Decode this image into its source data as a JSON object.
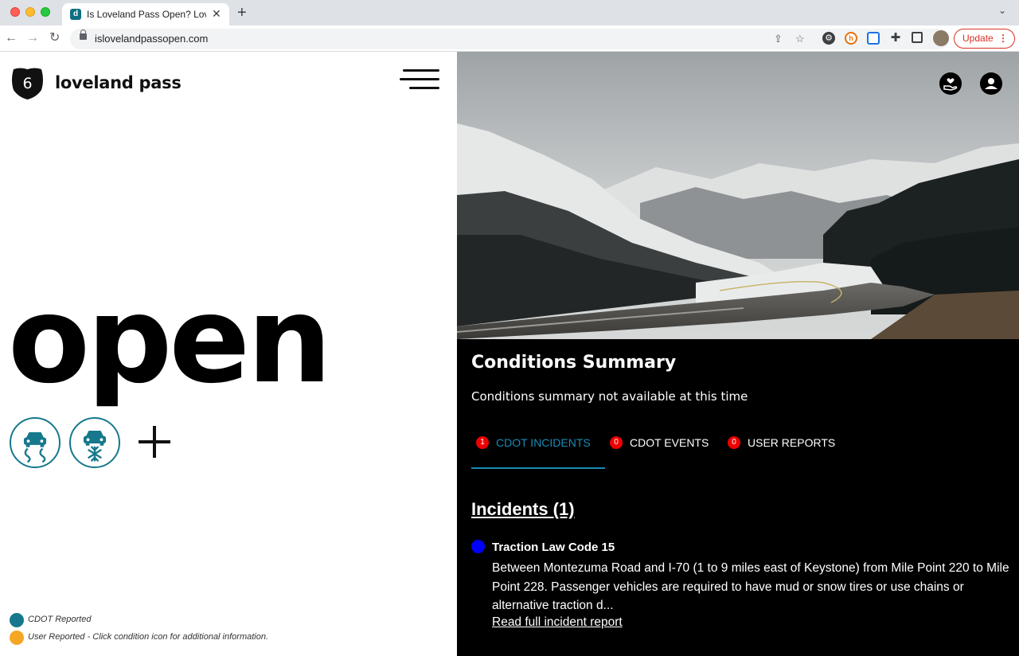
{
  "browser": {
    "tab_title": "Is Loveland Pass Open? Lovela",
    "tab_favicon_letter": "d",
    "url": "islovelandpassopen.com",
    "update_label": "Update"
  },
  "site": {
    "shield_number": "6",
    "brand": "loveland pass",
    "status": "open",
    "legend": [
      {
        "label": "CDOT Reported",
        "color": "#16788c"
      },
      {
        "label": "User Reported - Click condition icon for additional information.",
        "color": "#f5a623"
      }
    ]
  },
  "conditions": {
    "title": "Conditions Summary",
    "text": "Conditions summary not available at this time",
    "tabs": [
      {
        "count": "1",
        "label": "CDOT INCIDENTS",
        "active": true
      },
      {
        "count": "0",
        "label": "CDOT EVENTS",
        "active": false
      },
      {
        "count": "0",
        "label": "USER REPORTS",
        "active": false
      }
    ]
  },
  "incidents": {
    "heading": "Incidents (1)",
    "items": [
      {
        "title": "Traction Law Code 15",
        "body": "Between Montezuma Road and I-70 (1 to 9 miles east of Keystone) from Mile Point 220 to Mile Point 228. Passenger vehicles are required to have mud or snow tires or use chains or alternative traction d...",
        "link": "Read full incident report"
      }
    ]
  },
  "colors": {
    "accent": "#16788c",
    "active_tab": "#1a8ab5",
    "badge": "#ee0000",
    "incident_dot": "#0000ff"
  }
}
